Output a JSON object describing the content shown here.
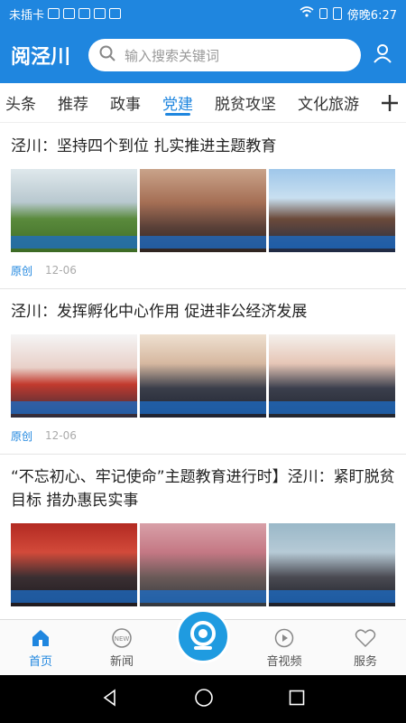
{
  "status_bar": {
    "carrier": "未插卡",
    "time": "傍晚6:27"
  },
  "header": {
    "brand": "阅泾川",
    "search_placeholder": "输入搜索关键词"
  },
  "tabs": [
    {
      "label": "头条"
    },
    {
      "label": "推荐"
    },
    {
      "label": "政事"
    },
    {
      "label": "党建",
      "active": true
    },
    {
      "label": "脱贫攻坚"
    },
    {
      "label": "文化旅游"
    }
  ],
  "articles": [
    {
      "title": "泾川：坚持四个到位 扎实推进主题教育",
      "tag": "原创",
      "date": "12-06"
    },
    {
      "title": "泾川：发挥孵化中心作用 促进非公经济发展",
      "tag": "原创",
      "date": "12-06"
    },
    {
      "title": "“不忘初心、牢记使命”主题教育进行时】泾川：紧盯脱贫目标 措办惠民实事",
      "tag": "",
      "date": ""
    }
  ],
  "bottom_nav": {
    "home": "首页",
    "news": "新闻",
    "av": "音视频",
    "service": "服务"
  },
  "colors": {
    "accent": "#1f86df"
  }
}
